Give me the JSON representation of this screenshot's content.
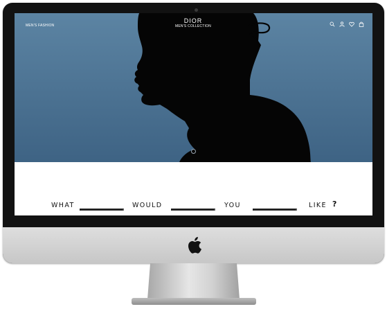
{
  "header": {
    "nav_left_label": "MEN'S FASHION",
    "brand_logo": "DIOR",
    "brand_subtitle": "MEN'S COLLECTION",
    "icons": [
      "search-icon",
      "user-icon",
      "heart-icon",
      "shopping-bag-icon"
    ]
  },
  "hero": {
    "background_top": "#5c84a3",
    "background_bottom": "#3e6384",
    "scroll_indicator_icon": "scroll-down-icon"
  },
  "question": {
    "word_1": "WHAT",
    "word_2": "WOULD",
    "word_3": "YOU",
    "word_4": "LIKE",
    "end_mark": "?",
    "blank_1_value": "",
    "blank_2_value": "",
    "blank_3_value": ""
  },
  "device": {
    "logo_icon": "apple-logo-icon"
  }
}
